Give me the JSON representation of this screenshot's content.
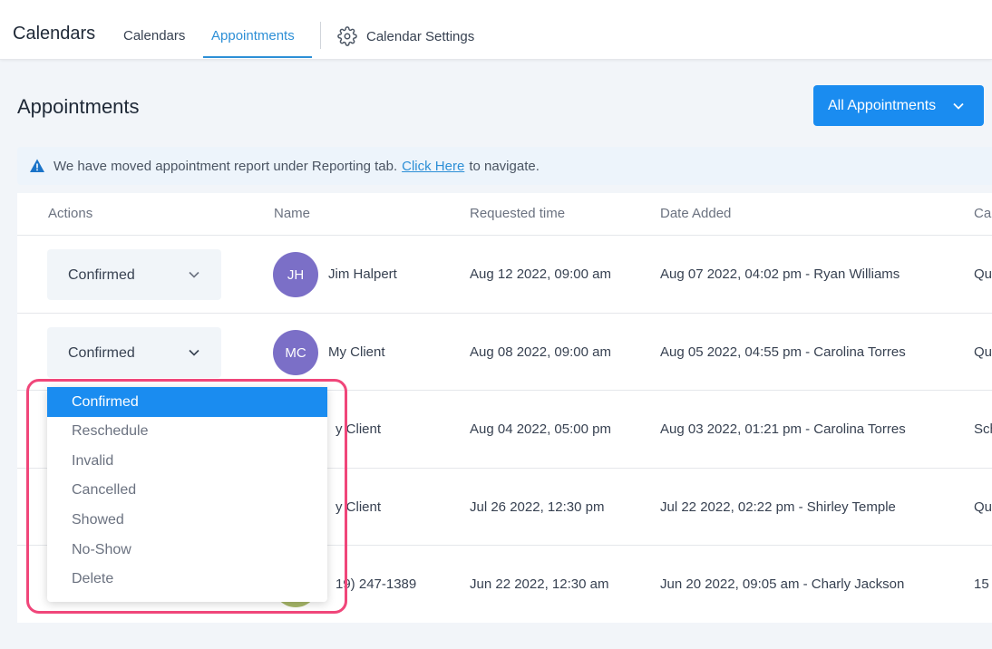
{
  "header": {
    "brand": "Calendars",
    "nav": {
      "calendars": "Calendars",
      "appointments": "Appointments",
      "settings": "Calendar Settings"
    }
  },
  "page": {
    "title": "Appointments",
    "filter_button": "All Appointments"
  },
  "banner": {
    "text_before": "We have moved appointment report under Reporting tab.",
    "link": "Click Here",
    "text_after": "to navigate."
  },
  "table": {
    "columns": {
      "actions": "Actions",
      "name": "Name",
      "requested_time": "Requested time",
      "date_added": "Date Added",
      "calendar": "Cal"
    },
    "rows": [
      {
        "status": "Confirmed",
        "initials": "JH",
        "name": "Jim Halpert",
        "requested": "Aug 12 2022, 09:00 am",
        "added": "Aug 07 2022, 04:02 pm - Ryan Williams",
        "calendar": "Qu"
      },
      {
        "status": "Confirmed",
        "initials": "MC",
        "name": "My Client",
        "requested": "Aug 08 2022, 09:00 am",
        "added": "Aug 05 2022, 04:55 pm - Carolina Torres",
        "calendar": "Qu"
      },
      {
        "name": "y Client",
        "requested": "Aug 04 2022, 05:00 pm",
        "added": "Aug 03 2022, 01:21 pm - Carolina Torres",
        "calendar": "Sch"
      },
      {
        "name": "y Client",
        "requested": "Jul 26 2022, 12:30 pm",
        "added": "Jul 22 2022, 02:22 pm - Shirley Temple",
        "calendar": "Qu"
      },
      {
        "name": "19) 247-1389",
        "requested": "Jun 22 2022, 12:30 am",
        "added": "Jun 20 2022, 09:05 am - Charly Jackson",
        "calendar": "15"
      }
    ]
  },
  "status_dropdown": {
    "options": [
      "Confirmed",
      "Reschedule",
      "Invalid",
      "Cancelled",
      "Showed",
      "No-Show",
      "Delete"
    ],
    "selected": "Confirmed"
  },
  "colors": {
    "accent": "#1a8cf0",
    "active_tab": "#2d8fd6",
    "avatar": "#7b6fc7",
    "highlight": "#f0467a"
  }
}
